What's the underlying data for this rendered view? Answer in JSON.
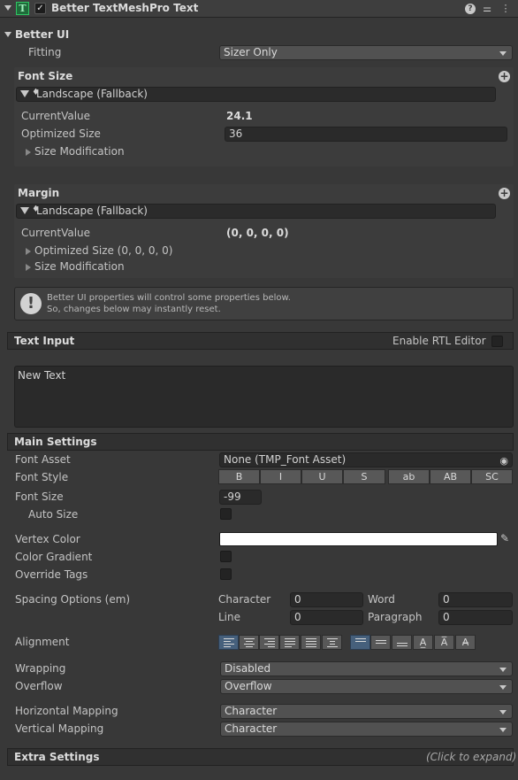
{
  "component": {
    "title": "Better TextMeshPro Text",
    "enabled": true,
    "icons": [
      "help-icon",
      "presets-icon",
      "kebab-menu-icon"
    ]
  },
  "better_ui": {
    "section_label": "Better UI",
    "fitting_label": "Fitting",
    "fitting_value": "Sizer Only",
    "font_size": {
      "header": "Font Size",
      "config": "Landscape (Fallback)",
      "current_value_label": "CurrentValue",
      "current_value": "24.1",
      "optimized_label": "Optimized Size",
      "optimized_value": "36",
      "size_mod_label": "Size Modification"
    },
    "margin": {
      "header": "Margin",
      "config": "Landscape (Fallback)",
      "current_value_label": "CurrentValue",
      "current_value": "(0, 0, 0, 0)",
      "optimized_label": "Optimized Size (0, 0, 0, 0)",
      "size_mod_label": "Size Modification"
    },
    "notice_line1": "Better UI properties will control some properties below.",
    "notice_line2": "So, changes below may instantly reset."
  },
  "text_input": {
    "header": "Text Input",
    "rtl_label": "Enable RTL Editor",
    "text": "New Text"
  },
  "main_settings": {
    "header": "Main Settings",
    "font_asset_label": "Font Asset",
    "font_asset_value": "None (TMP_Font Asset)",
    "font_style_label": "Font Style",
    "font_style_buttons": [
      "B",
      "I",
      "U",
      "S",
      "ab",
      "AB",
      "SC"
    ],
    "font_size_label": "Font Size",
    "font_size_value": "-99",
    "auto_size_label": "Auto Size",
    "vertex_color_label": "Vertex Color",
    "vertex_color": "#ffffff",
    "color_gradient_label": "Color Gradient",
    "override_tags_label": "Override Tags",
    "spacing_label": "Spacing Options (em)",
    "character_label": "Character",
    "character_value": "0",
    "word_label": "Word",
    "word_value": "0",
    "line_label": "Line",
    "line_value": "0",
    "paragraph_label": "Paragraph",
    "paragraph_value": "0",
    "alignment_label": "Alignment",
    "wrapping_label": "Wrapping",
    "wrapping_value": "Disabled",
    "overflow_label": "Overflow",
    "overflow_value": "Overflow",
    "horizontal_mapping_label": "Horizontal Mapping",
    "horizontal_mapping_value": "Character",
    "vertical_mapping_label": "Vertical Mapping",
    "vertical_mapping_value": "Character"
  },
  "extra_settings": {
    "header": "Extra Settings",
    "hint": "(Click to expand)"
  },
  "colors": {
    "background": "#383838",
    "accent": "#46607c",
    "component_icon": "#2fc463"
  }
}
